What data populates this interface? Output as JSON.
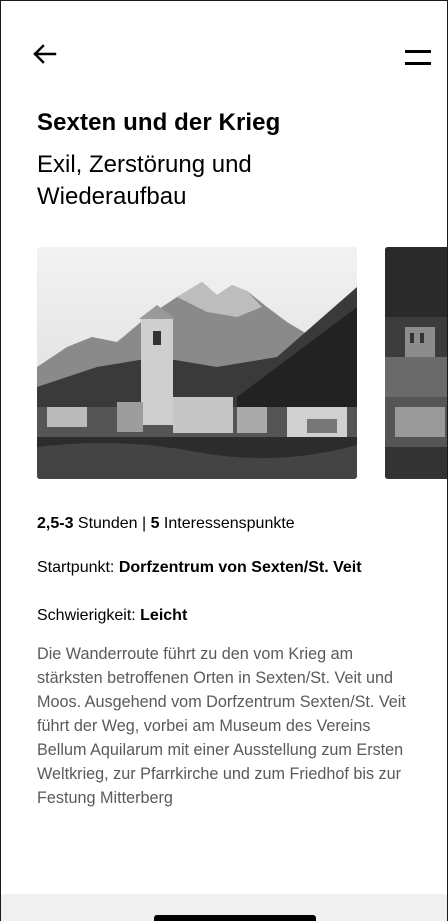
{
  "header": {
    "back_icon": "arrow-left-icon",
    "menu_icon": "menu-icon"
  },
  "tour": {
    "title": "Sexten und der Krieg",
    "subtitle": "Exil, Zerstörung und Wiederaufbau"
  },
  "gallery": {
    "images": [
      {
        "name": "photo-church-mountains"
      },
      {
        "name": "photo-ruins"
      }
    ]
  },
  "stats": {
    "duration_value": "2,5-3",
    "duration_unit": " Stunden | ",
    "poi_count": "5",
    "poi_label": " Interessenspunkte"
  },
  "info": {
    "start_label": "Startpunkt: ",
    "start_value": "Dorfzentrum von Sexten/St. Veit",
    "difficulty_label": "Schwierigkeit: ",
    "difficulty_value": "Leicht"
  },
  "description": "Die Wanderroute führt zu den vom Krieg am stärksten betroffenen Orten in Sexten/St. Veit und Moos. Ausgehend vom Dorfzentrum Sexten/St. Veit führt der Weg, vorbei am Museum des Vereins Bellum Aquilarum mit einer Ausstellung zum Ersten Weltkrieg, zur Pfarrkirche und zum Friedhof bis zur Festung Mitterberg",
  "colors": {
    "description_text": "#5a5a5a",
    "bottom_bar": "#f0f0f0"
  }
}
